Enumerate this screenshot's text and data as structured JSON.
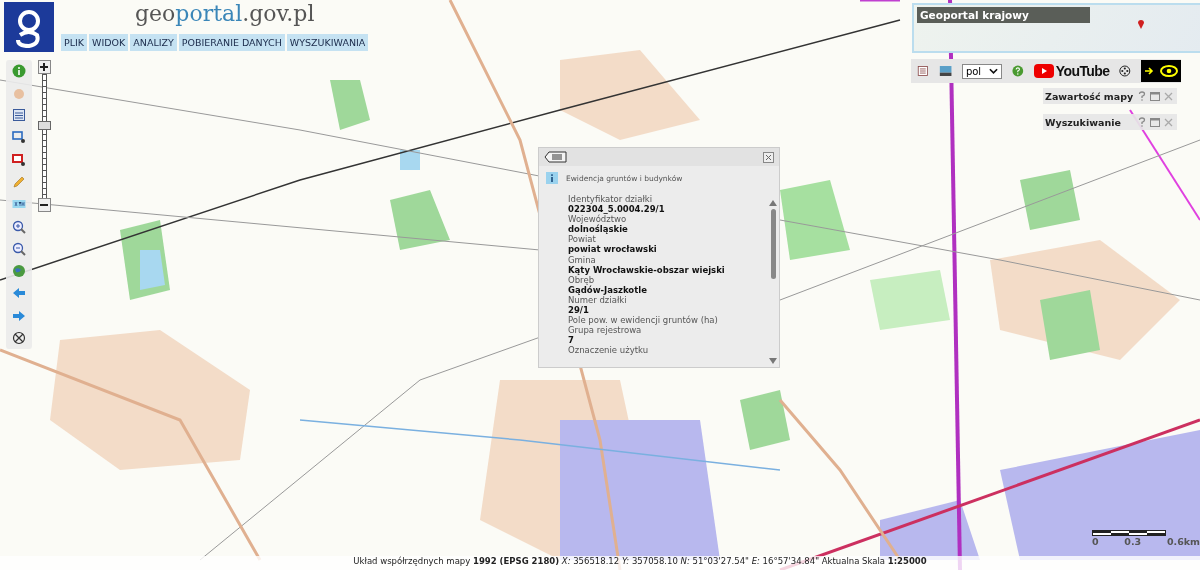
{
  "logo": {
    "parts": [
      {
        "text": "geo",
        "accent": false
      },
      {
        "text": "portal",
        "accent": true
      },
      {
        "text": ".gov.pl",
        "accent": false
      }
    ]
  },
  "menu": [
    "PLIK",
    "WIDOK",
    "ANALIZY",
    "POBIERANIE DANYCH",
    "WYSZUKIWANIA"
  ],
  "zoom_slider": {
    "level": 0.58
  },
  "overview_map": {
    "title": "Geoportal krajowy"
  },
  "toolbar": {
    "language": "pol",
    "video_label": "YouTube"
  },
  "panels": [
    {
      "title": "Zawartość mapy"
    },
    {
      "title": "Wyszukiwanie"
    }
  ],
  "popup": {
    "layer": "Ewidencja gruntów i budynków",
    "fields": [
      {
        "label": "Identyfikator działki",
        "value": "022304_5.0004.29/1"
      },
      {
        "label": "Województwo",
        "value": "dolnośląskie"
      },
      {
        "label": "Powiat",
        "value": "powiat wrocławski"
      },
      {
        "label": "Gmina",
        "value": "Kąty Wrocławskie-obszar wiejski"
      },
      {
        "label": "Obręb",
        "value": "Gądów-Jaszkotle"
      },
      {
        "label": "Numer działki",
        "value": "29/1"
      },
      {
        "label": "Pole pow. w ewidencji gruntów (ha)"
      },
      {
        "label": "Grupa rejestrowa",
        "value": "7"
      },
      {
        "label": "Oznaczenie użytku"
      }
    ]
  },
  "scale_bar": {
    "labels": [
      "0",
      "0.3",
      "0.6km"
    ]
  },
  "status_bar": "Układ współrzędnych mapy **1992 (EPSG 2180)**   *X:* 356518.12 *Y:* 357058.10   *N:* 51°03'27.54\" *E:* 16°57'34.84\"   Aktualna Skala **1:25000**"
}
